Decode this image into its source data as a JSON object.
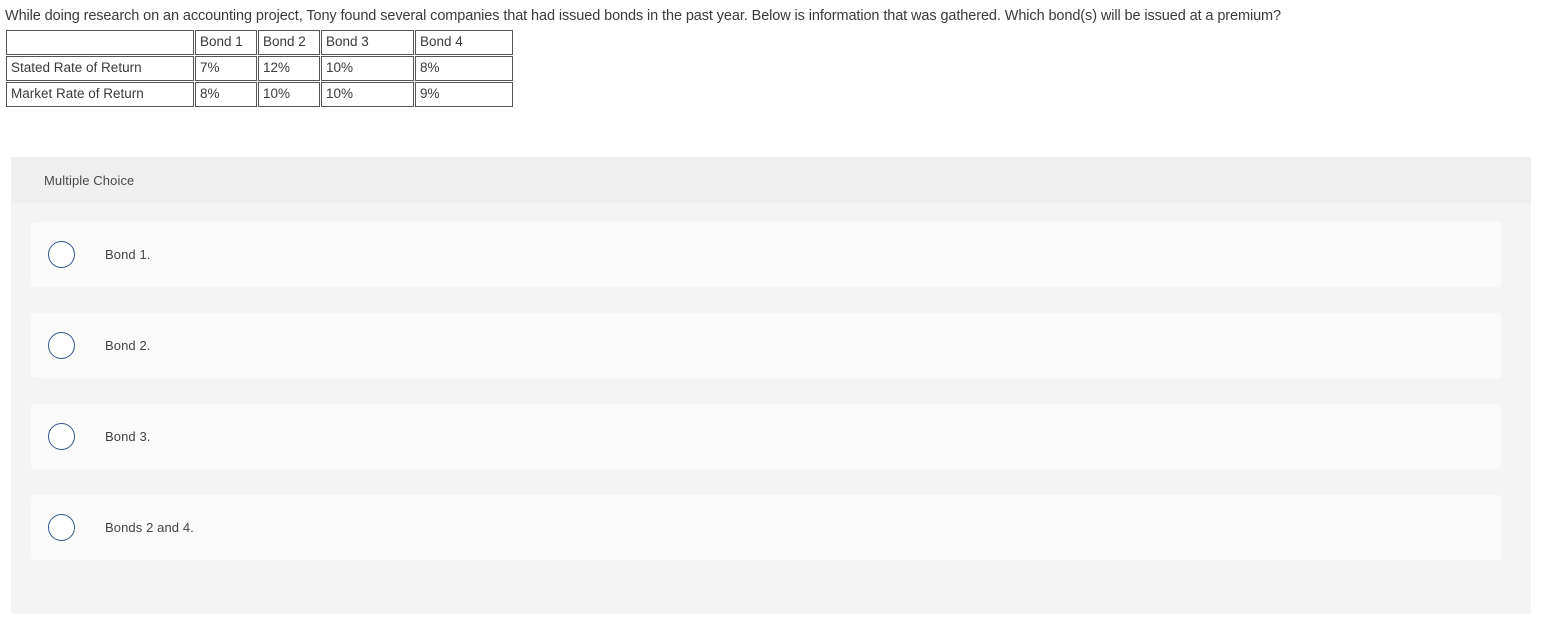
{
  "question": {
    "stem": "While doing research on an accounting project, Tony found several companies that had issued bonds in the past year.  Below is information that was gathered.  Which bond(s) will be issued at a premium?"
  },
  "table": {
    "corner_label": "",
    "columns": [
      "Bond 1",
      "Bond 2",
      "Bond 3",
      "Bond 4"
    ],
    "rows": [
      {
        "label": "Stated Rate of Return",
        "values": [
          "7%",
          "12%",
          "10%",
          "8%"
        ]
      },
      {
        "label": "Market Rate of Return",
        "values": [
          "8%",
          "10%",
          "10%",
          "9%"
        ]
      }
    ]
  },
  "answer_panel": {
    "header_label": "Multiple Choice",
    "options": [
      {
        "label": "Bond 1.",
        "selected": false
      },
      {
        "label": "Bond 2.",
        "selected": false
      },
      {
        "label": "Bond 3.",
        "selected": false
      },
      {
        "label": "Bonds 2 and 4.",
        "selected": false
      }
    ]
  },
  "colors": {
    "page_background": "#ffffff",
    "panel_background": "#f4f4f4",
    "panel_header_background": "#efefef",
    "option_card_background": "#fafafa",
    "radio_border": "#33558c",
    "text_primary": "#3a3a3a",
    "text_secondary": "#444444",
    "table_border": "#555555"
  }
}
